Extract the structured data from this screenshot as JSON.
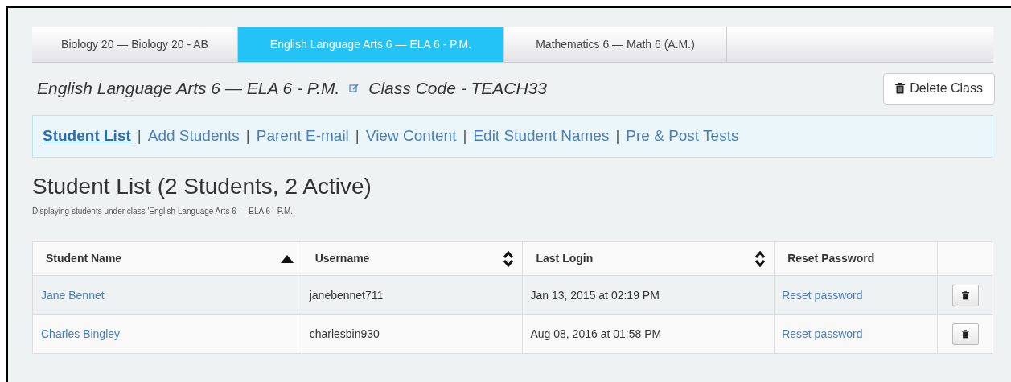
{
  "tabs": [
    {
      "label": "Biology 20 — Biology 20 - AB",
      "selected": false
    },
    {
      "label": "English Language Arts 6 — ELA 6 - P.M.",
      "selected": true
    },
    {
      "label": "Mathematics 6 — Math 6 (A.M.)",
      "selected": false
    }
  ],
  "class_heading": {
    "name": "English Language Arts 6 —  ELA 6 - P.M.",
    "code": "Class Code - TEACH33"
  },
  "delete_class_button": "Delete Class",
  "nav_links": [
    {
      "label": "Student List",
      "selected": true
    },
    {
      "label": "Add Students",
      "selected": false
    },
    {
      "label": "Parent E-mail",
      "selected": false
    },
    {
      "label": "View Content",
      "selected": false
    },
    {
      "label": "Edit Student Names",
      "selected": false
    },
    {
      "label": "Pre & Post Tests",
      "selected": false
    }
  ],
  "nav_separator": "|",
  "title": "Student List (2 Students, 2 Active)",
  "subtitle": "Displaying students under class 'English Language Arts 6 — ELA 6 - P.M.",
  "table": {
    "columns": [
      {
        "label": "Student Name",
        "sortable": true,
        "sorted_ascending": true
      },
      {
        "label": "Username",
        "sortable": true,
        "sorted_ascending": false
      },
      {
        "label": "Last Login",
        "sortable": true,
        "sorted_ascending": false
      },
      {
        "label": "Reset Password",
        "sortable": false
      }
    ],
    "rows": [
      {
        "student_name": "Jane Bennet",
        "username": "janebennet711",
        "last_login": "Jan 13, 2015 at 02:19 PM",
        "reset": "Reset password"
      },
      {
        "student_name": "Charles Bingley",
        "username": "charlesbin930",
        "last_login": "Aug 08, 2016 at 01:58 PM",
        "reset": "Reset password"
      }
    ]
  }
}
